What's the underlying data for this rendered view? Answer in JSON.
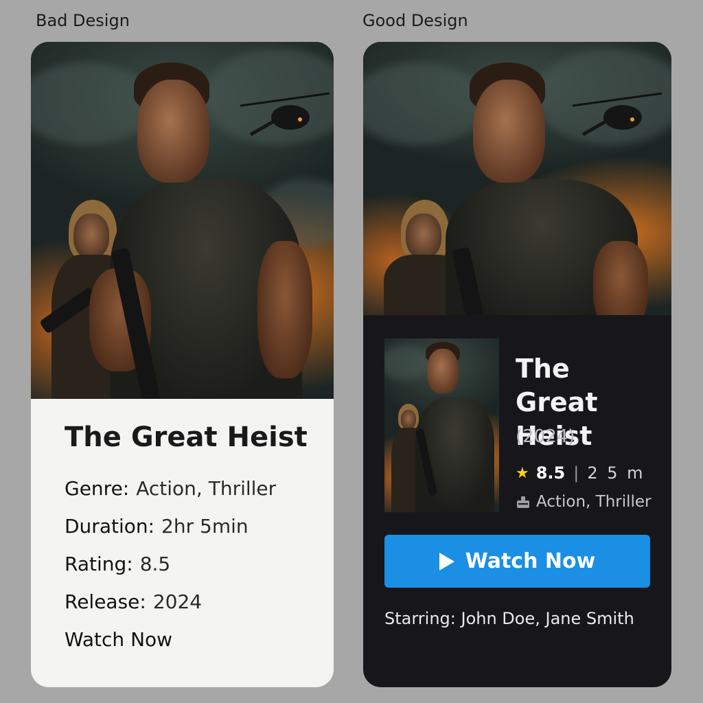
{
  "sections": {
    "bad_label": "Bad Design",
    "good_label": "Good Design"
  },
  "movie": {
    "title": "The Great Heist"
  },
  "bad": {
    "genre_label": "Genre:",
    "genre_value": "Action, Thriller",
    "duration_label": "Duration:",
    "duration_value": "2hr 5min",
    "rating_label": "Rating:",
    "rating_value": "8.5",
    "release_label": "Release:",
    "release_value": "2024",
    "watch_label": "Watch Now"
  },
  "good": {
    "title_line1": "The Great",
    "title_line2": "Heist",
    "year": "(2024)",
    "rating": "8.5",
    "separator": "|",
    "duration": "2 5 m",
    "genre": "Action, Thriller",
    "watch_button": "Watch Now",
    "starring": "Starring: John Doe, Jane Smith"
  },
  "icons": {
    "rating": "star-icon",
    "genre": "clapperboard-icon",
    "play": "play-icon"
  },
  "colors": {
    "page_bg": "#a7a7a7",
    "bad_card_bg": "#f4f5f3",
    "good_card_bg": "#17171b",
    "button_blue": "#1a8fe4",
    "star_yellow": "#f6d31c"
  }
}
